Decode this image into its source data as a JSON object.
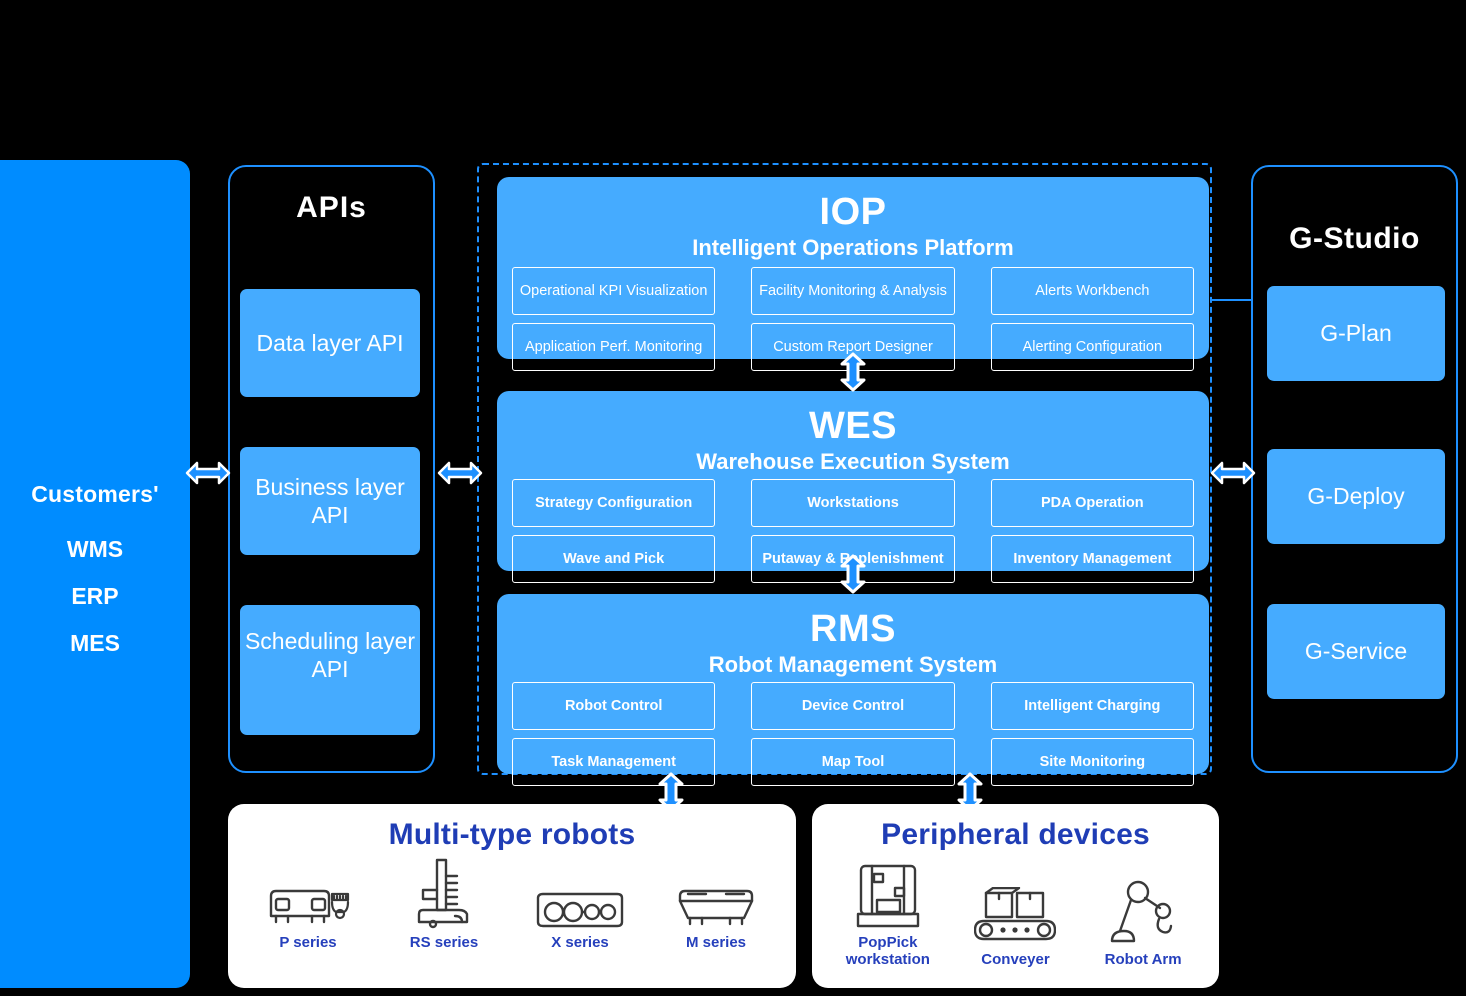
{
  "customers": {
    "title": "Customers'",
    "items": [
      "WMS",
      "ERP",
      "MES"
    ]
  },
  "apis": {
    "title": "APIs",
    "boxes": [
      {
        "label": "Data layer API",
        "name": "data-layer-api"
      },
      {
        "label": "Business layer API",
        "name": "business-layer-api"
      },
      {
        "label": "Scheduling layer API",
        "name": "scheduling-layer-api"
      }
    ]
  },
  "core": {
    "layers": [
      {
        "abbr": "IOP",
        "full": "Intelligent Operations Platform",
        "tiles": [
          "Operational KPI Visualization",
          "Facility Monitoring & Analysis",
          "Alerts Workbench",
          "Application Perf. Monitoring",
          "Custom Report Designer",
          "Alerting Configuration"
        ]
      },
      {
        "abbr": "WES",
        "full": "Warehouse Execution System",
        "tiles": [
          "Strategy Configuration",
          "Workstations",
          "PDA Operation",
          "Wave and Pick",
          "Putaway & Replenishment",
          "Inventory Management"
        ]
      },
      {
        "abbr": "RMS",
        "full": "Robot Management System",
        "tiles": [
          "Robot Control",
          "Device Control",
          "Intelligent Charging",
          "Task Management",
          "Map Tool",
          "Site Monitoring"
        ]
      }
    ]
  },
  "gstudio": {
    "title": "G-Studio",
    "boxes": [
      {
        "label": "G-Plan",
        "name": "g-plan"
      },
      {
        "label": "G-Deploy",
        "name": "g-deploy"
      },
      {
        "label": "G-Service",
        "name": "g-service"
      }
    ]
  },
  "robots": {
    "title": "Multi-type robots",
    "items": [
      {
        "label": "P series",
        "icon": "p-series-robot-icon"
      },
      {
        "label": "RS series",
        "icon": "rs-series-robot-icon"
      },
      {
        "label": "X series",
        "icon": "x-series-robot-icon"
      },
      {
        "label": "M series",
        "icon": "m-series-robot-icon"
      }
    ]
  },
  "peripherals": {
    "title": "Peripheral devices",
    "items": [
      {
        "label": "PopPick workstation",
        "icon": "poppick-workstation-icon"
      },
      {
        "label": "Conveyer",
        "icon": "conveyer-icon"
      },
      {
        "label": "Robot Arm",
        "icon": "robot-arm-icon"
      }
    ]
  },
  "colors": {
    "brand_blue": "#008CFF",
    "panel_blue": "#45ABFF",
    "border_blue": "#1E90FF",
    "label_navy": "#2640BC",
    "background": "#000000",
    "panel_white": "#FFFFFF"
  }
}
